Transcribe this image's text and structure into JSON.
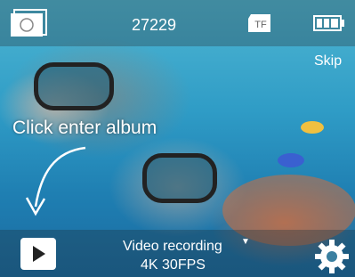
{
  "status": {
    "photo_count": "27229",
    "storage_label": "TF"
  },
  "skip_label": "Skip",
  "hint_text": "Click enter album",
  "mode": {
    "label": "Video recording",
    "value": "4K 30FPS"
  },
  "icons": {
    "photo": "photo-album-icon",
    "storage": "sd-card-icon",
    "battery": "battery-icon",
    "play": "play-icon",
    "settings": "gear-icon",
    "arrow": "curved-arrow-icon",
    "dropdown": "dropdown-triangle-icon"
  },
  "colors": {
    "foreground": "#ffffff"
  }
}
